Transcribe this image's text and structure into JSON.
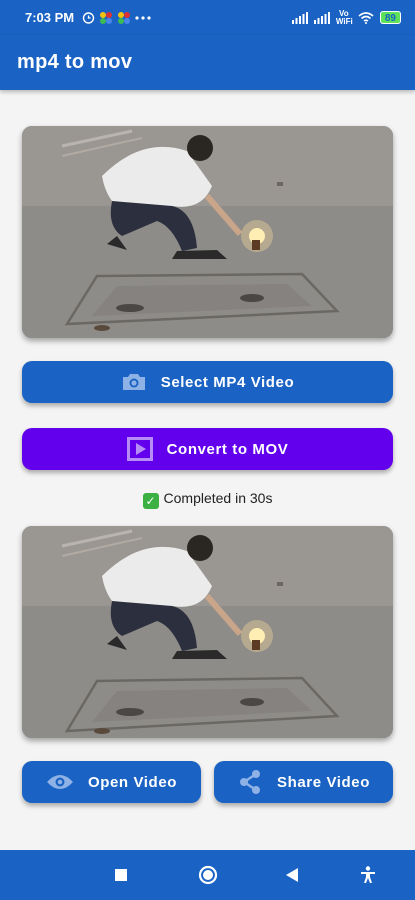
{
  "status_bar": {
    "time": "7:03 PM",
    "battery": "89",
    "network": "Vo WiFi"
  },
  "app_bar": {
    "title": "mp4 to mov"
  },
  "buttons": {
    "select": "Select MP4 Video",
    "convert": "Convert to MOV",
    "open": "Open Video",
    "share": "Share Video"
  },
  "status": {
    "text": "Completed in 30s"
  },
  "colors": {
    "primary": "#1a63c4",
    "convert": "#6200ee",
    "success": "#3cb043"
  },
  "icons": {
    "select": "camera-icon",
    "convert": "play-box-icon",
    "open": "eye-icon",
    "share": "share-icon"
  }
}
